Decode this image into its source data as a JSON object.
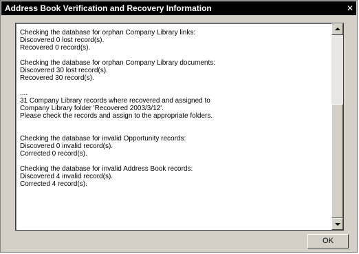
{
  "window": {
    "title": "Address Book Verification and Recovery Information",
    "close_glyph": "✕"
  },
  "log": {
    "lines": [
      "Checking the database for orphan Company Library links:",
      "Discovered 0 lost record(s).",
      "Recovered 0 record(s).",
      "",
      "Checking the database for orphan Company Library documents:",
      "Discovered 30 lost record(s).",
      "Recovered 30 record(s).",
      "",
      "....",
      "31 Company Library records where recovered and assigned to",
      "Company Library folder 'Recovered 2003/3/12'.",
      "Please check the records and assign to the appropriate folders.",
      "",
      "",
      "Checking the database for invalid Opportunity records:",
      "Discovered 0 invalid record(s).",
      "Corrected 0 record(s).",
      "",
      "Checking the database for invalid Address Book records:",
      "Discovered 4 invalid record(s).",
      "Corrected 4 record(s)."
    ]
  },
  "buttons": {
    "ok_label": "OK"
  }
}
